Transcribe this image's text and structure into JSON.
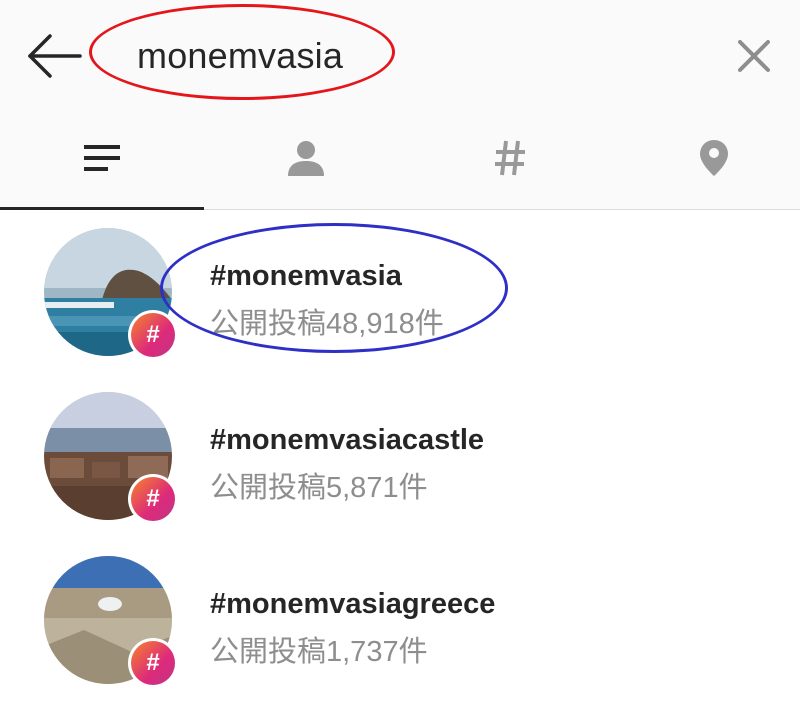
{
  "search": {
    "query": "monemvasia"
  },
  "tabs": [
    {
      "icon": "top-results-icon",
      "active": true
    },
    {
      "icon": "person-icon",
      "active": false
    },
    {
      "icon": "hashtag-icon",
      "active": false
    },
    {
      "icon": "location-pin-icon",
      "active": false
    }
  ],
  "results": [
    {
      "name": "#monemvasia",
      "count": "公開投稿48,918件"
    },
    {
      "name": "#monemvasiacastle",
      "count": "公開投稿5,871件"
    },
    {
      "name": "#monemvasiagreece",
      "count": "公開投稿1,737件"
    }
  ],
  "badge": {
    "symbol": "#"
  },
  "colors": {
    "annotation_red": "#e4161b",
    "annotation_blue": "#2d2fc6",
    "icon_gray": "#999999",
    "text_dark": "#262626",
    "text_gray": "#8e8e8e"
  }
}
